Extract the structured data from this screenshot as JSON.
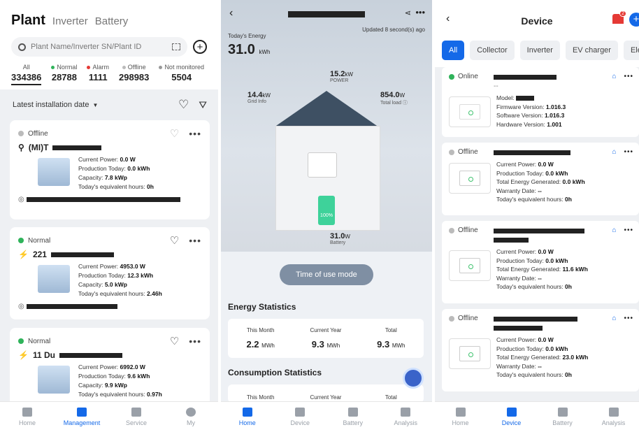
{
  "screen1": {
    "tabs": [
      "Plant",
      "Inverter",
      "Battery"
    ],
    "search_placeholder": "Plant Name/Inverter SN/Plant ID",
    "stats": [
      {
        "label": "All",
        "value": "334386",
        "color": ""
      },
      {
        "label": "Normal",
        "value": "28788",
        "color": "#2fb35a"
      },
      {
        "label": "Alarm",
        "value": "1111",
        "color": "#e53935"
      },
      {
        "label": "Offline",
        "value": "298983",
        "color": "#bbbbbb"
      },
      {
        "label": "Not monitored",
        "value": "5504",
        "color": "#999999"
      }
    ],
    "sort_label": "Latest installation date",
    "cards": [
      {
        "status": "Offline",
        "status_color": "#bbbbbb",
        "name": "(MI)T",
        "power_label": "Current Power:",
        "power": "0.0 W",
        "prod_label": "Production Today:",
        "prod": "0.0 kWh",
        "cap_label": "Capacity:",
        "cap": "7.8 kWp",
        "hours_label": "Today's equivalent hours:",
        "hours": "0h"
      },
      {
        "status": "Normal",
        "status_color": "#2fb35a",
        "name": "221",
        "power_label": "Current Power:",
        "power": "4953.0 W",
        "prod_label": "Production Today:",
        "prod": "12.3 kWh",
        "cap_label": "Capacity:",
        "cap": "5.0 kWp",
        "hours_label": "Today's equivalent hours:",
        "hours": "2.46h"
      },
      {
        "status": "Normal",
        "status_color": "#2fb35a",
        "name": "11 Du",
        "power_label": "Current Power:",
        "power": "6992.0 W",
        "prod_label": "Production Today:",
        "prod": "9.6 kWh",
        "cap_label": "Capacity:",
        "cap": "9.9 kWp",
        "hours_label": "Today's equivalent hours:",
        "hours": "0.97h"
      }
    ],
    "nav": [
      "Home",
      "Management",
      "Service",
      "My"
    ]
  },
  "screen2": {
    "updated": "Updated 8 second(s) ago",
    "todays_energy_label": "Today's Energy",
    "todays_energy_value": "31.0",
    "todays_energy_unit": "kWh",
    "grid": {
      "value": "14.4",
      "unit": "kW",
      "label": "Grid Info"
    },
    "power": {
      "value": "15.2",
      "unit": "kW",
      "label": "POWER"
    },
    "load": {
      "value": "854.0",
      "unit": "W",
      "label": "Total load"
    },
    "battery": {
      "value": "31.0",
      "unit": "W",
      "label": "Battery",
      "soc": "100%"
    },
    "tou_button": "Time of use mode",
    "energy_title": "Energy Statistics",
    "energy": [
      {
        "label": "This Month",
        "value": "2.2",
        "unit": "MWh"
      },
      {
        "label": "Current Year",
        "value": "9.3",
        "unit": "MWh"
      },
      {
        "label": "Total",
        "value": "9.3",
        "unit": "MWh"
      }
    ],
    "consumption_title": "Consumption Statistics",
    "consumption": [
      "This Month",
      "Current Year",
      "Total"
    ],
    "nav": [
      "Home",
      "Device",
      "Battery",
      "Analysis"
    ]
  },
  "screen3": {
    "title": "Device",
    "alarm_badge": "2",
    "chips": [
      "All",
      "Collector",
      "Inverter",
      "EV charger",
      "Electric m"
    ],
    "cards": [
      {
        "status": "Online",
        "status_color": "#2fb35a",
        "sub": "--",
        "l1": "Model:",
        "v1": "",
        "l2": "Firmware Version:",
        "v2": "1.016.3",
        "l3": "Software Version:",
        "v3": "1.016.3",
        "l4": "Hardware Version:",
        "v4": "1.001"
      },
      {
        "status": "Offline",
        "status_color": "#bbbbbb",
        "l1": "Current Power:",
        "v1": "0.0 W",
        "l2": "Production Today:",
        "v2": "0.0 kWh",
        "l3": "Total Energy Generated:",
        "v3": "0.0 kWh",
        "l4": "Warranty Date:",
        "v4": "--",
        "l5": "Today's equivalent hours:",
        "v5": "0h"
      },
      {
        "status": "Offline",
        "status_color": "#bbbbbb",
        "l1": "Current Power:",
        "v1": "0.0 W",
        "l2": "Production Today:",
        "v2": "0.0 kWh",
        "l3": "Total Energy Generated:",
        "v3": "11.6 kWh",
        "l4": "Warranty Date:",
        "v4": "--",
        "l5": "Today's equivalent hours:",
        "v5": "0h"
      },
      {
        "status": "Offline",
        "status_color": "#bbbbbb",
        "l1": "Current Power:",
        "v1": "0.0 W",
        "l2": "Production Today:",
        "v2": "0.0 kWh",
        "l3": "Total Energy Generated:",
        "v3": "23.0 kWh",
        "l4": "Warranty Date:",
        "v4": "--",
        "l5": "Today's equivalent hours:",
        "v5": "0h"
      }
    ],
    "nav": [
      "Home",
      "Device",
      "Battery",
      "Analysis"
    ]
  }
}
